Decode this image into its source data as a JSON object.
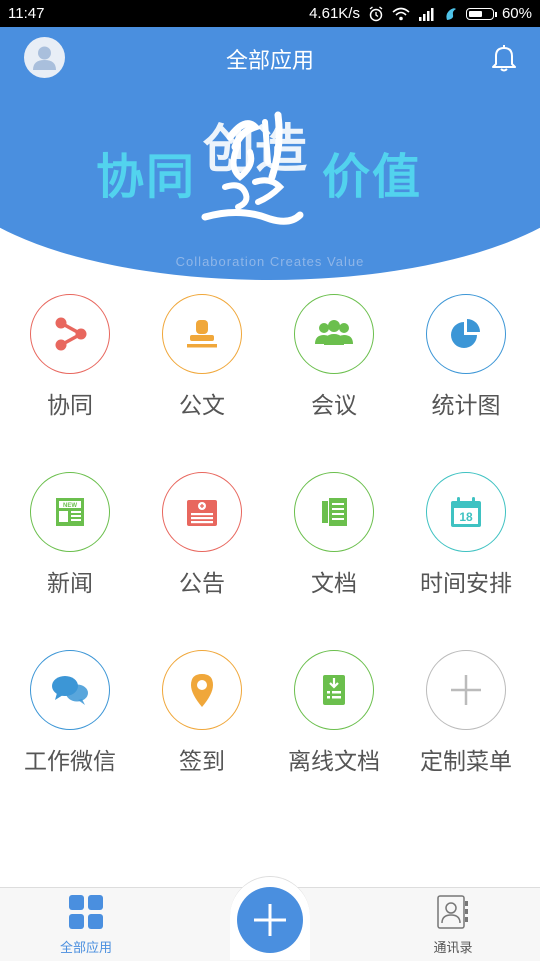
{
  "status_bar": {
    "time": "11:47",
    "network_speed": "4.61K/s",
    "battery": "60%",
    "battery_level": 0.6
  },
  "header": {
    "title": "全部应用",
    "slogan_left": "协同",
    "slogan_right": "价值",
    "slogan_calligraphy": "创造",
    "slogan_en": "Collaboration Creates Value",
    "background_color": "#4a8fdf"
  },
  "apps": [
    {
      "label": "协同",
      "icon": "share-icon",
      "color": "#e8675e"
    },
    {
      "label": "公文",
      "icon": "stamp-icon",
      "color": "#f0a73a"
    },
    {
      "label": "会议",
      "icon": "meeting-icon",
      "color": "#6bbf4d"
    },
    {
      "label": "统计图",
      "icon": "pie-chart-icon",
      "color": "#3c96d6"
    },
    {
      "label": "新闻",
      "icon": "news-icon",
      "color": "#6bbf4d"
    },
    {
      "label": "公告",
      "icon": "announcement-icon",
      "color": "#e8675e"
    },
    {
      "label": "文档",
      "icon": "document-icon",
      "color": "#6bbf4d"
    },
    {
      "label": "时间安排",
      "icon": "calendar-icon",
      "color": "#3fc2c2",
      "calendar_day": "18"
    },
    {
      "label": "工作微信",
      "icon": "chat-icon",
      "color": "#3c96d6"
    },
    {
      "label": "签到",
      "icon": "location-pin-icon",
      "color": "#f0a73a"
    },
    {
      "label": "离线文档",
      "icon": "download-document-icon",
      "color": "#6bbf4d"
    },
    {
      "label": "定制菜单",
      "icon": "plus-icon",
      "color": "#bbbbbb"
    }
  ],
  "bottom_nav": {
    "left_label": "全部应用",
    "right_label": "通讯录",
    "active_color": "#4a8fdf"
  }
}
